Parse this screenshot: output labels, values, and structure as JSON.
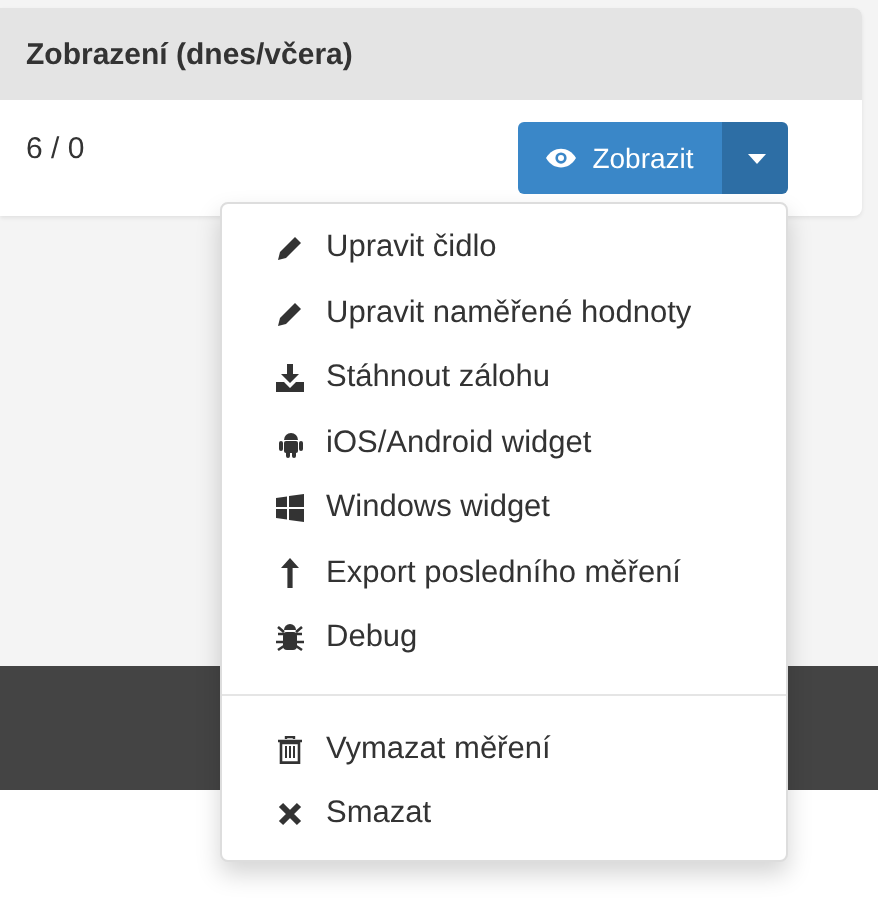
{
  "panel": {
    "title": "Zobrazení (dnes/včera)",
    "value": "6 / 0"
  },
  "button": {
    "label": "Zobrazit",
    "menu_expanded": true
  },
  "menu": {
    "sections": [
      [
        {
          "kind": "pencil",
          "label": "Upravit čidlo"
        },
        {
          "kind": "pencil",
          "label": "Upravit naměřené hodnoty"
        },
        {
          "kind": "download",
          "label": "Stáhnout zálohu"
        },
        {
          "kind": "android",
          "label": "iOS/Android widget"
        },
        {
          "kind": "windows",
          "label": "Windows widget"
        },
        {
          "kind": "arrow-up",
          "label": "Export posledního měření"
        },
        {
          "kind": "bug",
          "label": "Debug"
        }
      ],
      [
        {
          "kind": "trash",
          "label": "Vymazat měření"
        },
        {
          "kind": "times",
          "label": "Smazat"
        }
      ]
    ]
  }
}
